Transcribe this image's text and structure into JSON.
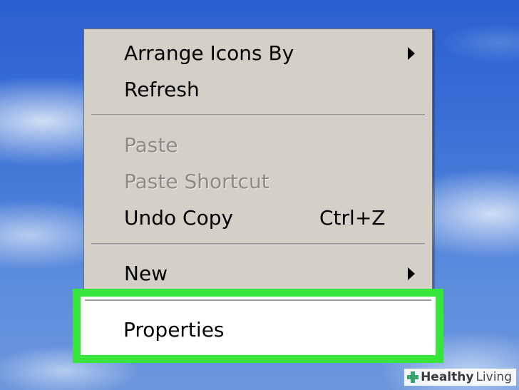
{
  "menu": {
    "items": [
      {
        "label": "Arrange Icons By",
        "submenu": true,
        "enabled": true
      },
      {
        "label": "Refresh",
        "enabled": true
      },
      {
        "label": "Paste",
        "enabled": false
      },
      {
        "label": "Paste Shortcut",
        "enabled": false
      },
      {
        "label": "Undo Copy",
        "shortcut": "Ctrl+Z",
        "enabled": true
      },
      {
        "label": "New",
        "submenu": true,
        "enabled": true
      },
      {
        "label": "Properties",
        "enabled": true,
        "highlighted": true
      }
    ]
  },
  "highlight": {
    "color": "#37e63b"
  },
  "watermark": {
    "brand": "Healthy",
    "suffix": "Living"
  }
}
